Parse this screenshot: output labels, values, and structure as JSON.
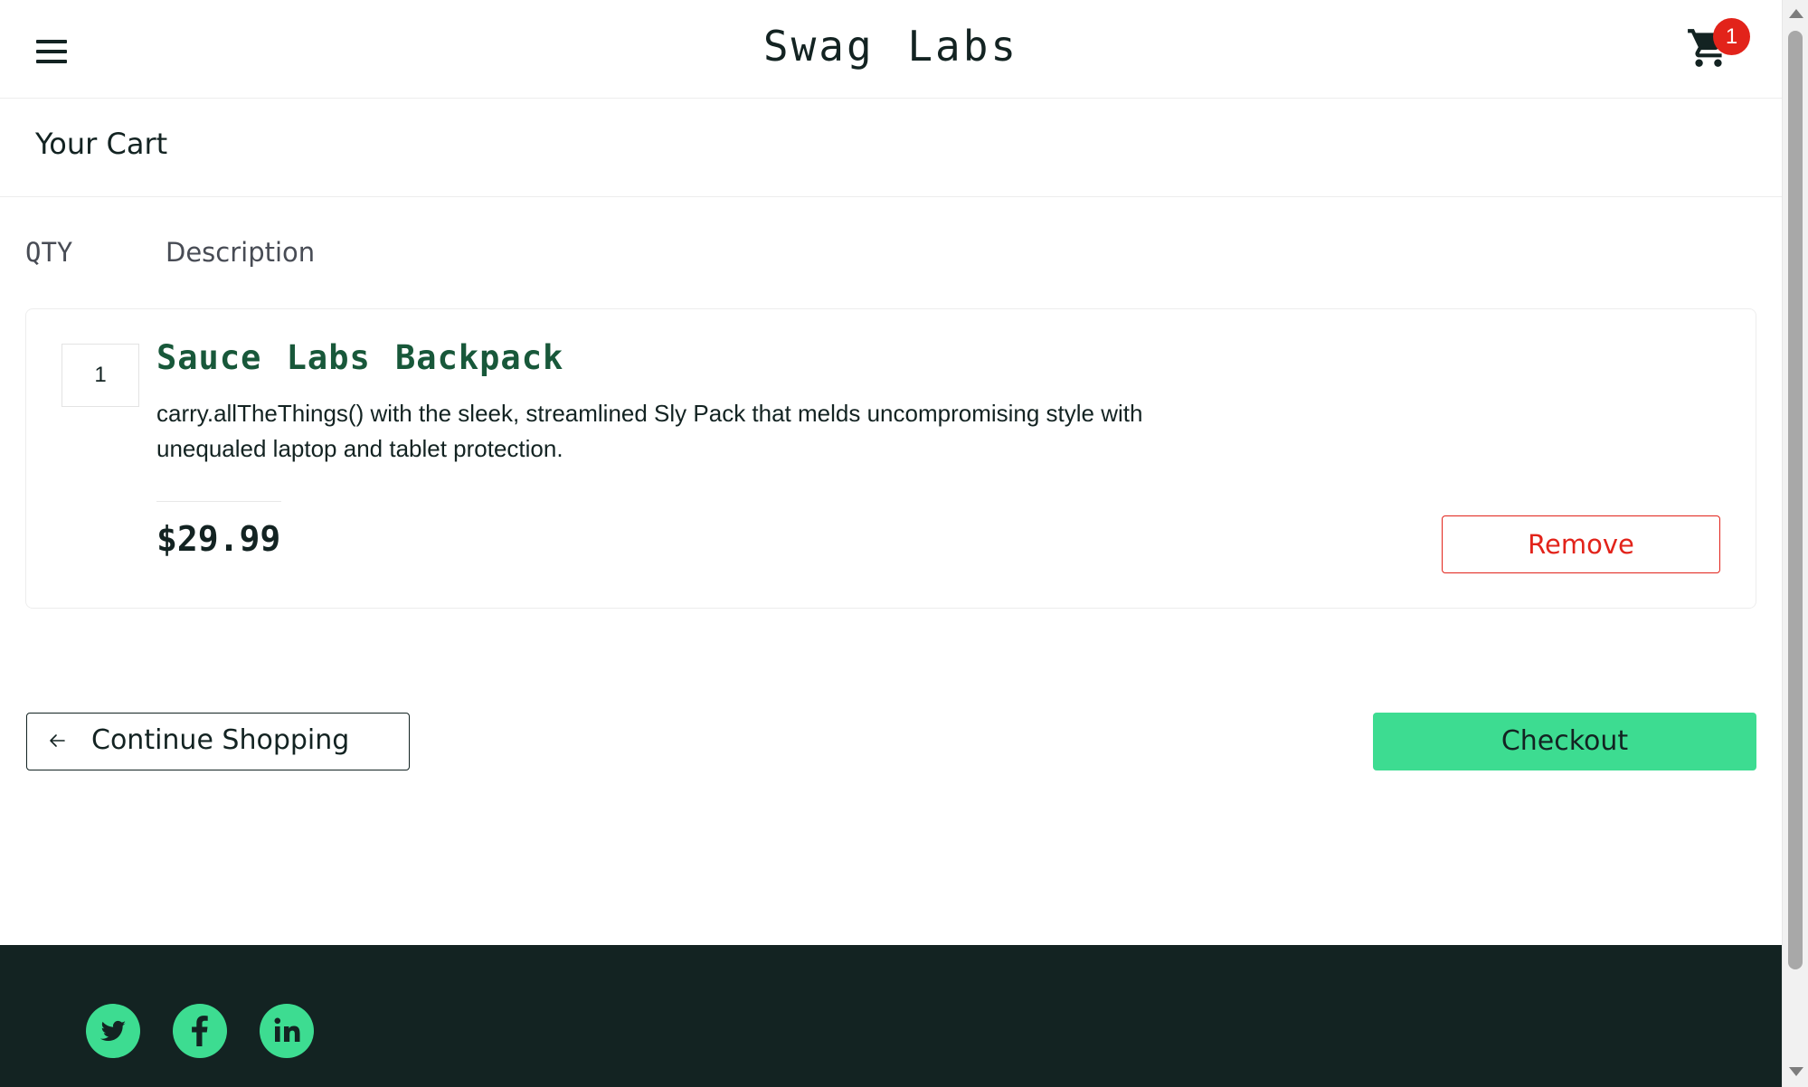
{
  "header": {
    "logo": "Swag Labs",
    "menu_icon": "hamburger-menu-icon",
    "cart_icon": "shopping-cart-icon",
    "cart_badge": "1"
  },
  "page": {
    "title": "Your Cart"
  },
  "cart_list": {
    "qty_label": "QTY",
    "desc_label": "Description",
    "items": [
      {
        "quantity": "1",
        "name": "Sauce Labs Backpack",
        "description": "carry.allTheThings() with the sleek, streamlined Sly Pack that melds uncompromising style with unequaled laptop and tablet protection.",
        "price": "$29.99",
        "remove_label": "Remove"
      }
    ]
  },
  "actions": {
    "continue_label": "Continue Shopping",
    "continue_icon": "arrow-left-icon",
    "checkout_label": "Checkout"
  },
  "footer": {
    "social": [
      "twitter-icon",
      "facebook-icon",
      "linkedin-icon"
    ]
  },
  "colors": {
    "brand_dark": "#132322",
    "accent_green": "#3ddc91",
    "item_name": "#18583a",
    "danger": "#e2231a"
  }
}
